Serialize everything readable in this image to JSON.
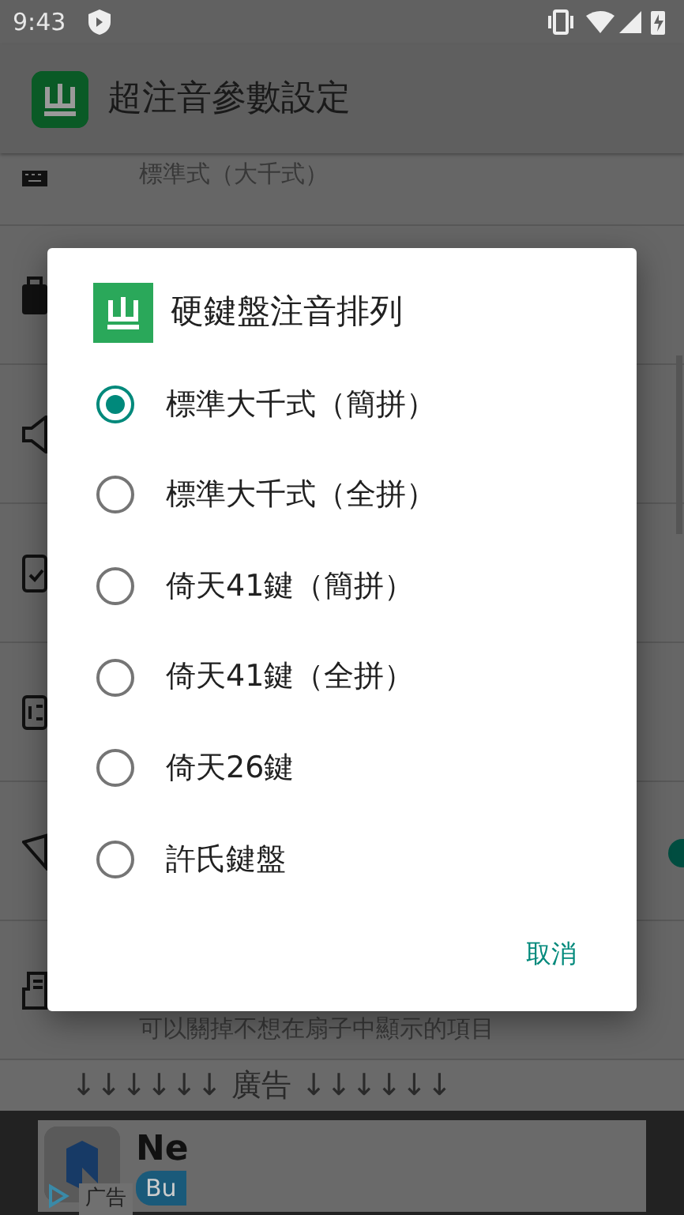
{
  "status_bar": {
    "time": "9:43"
  },
  "app_bar": {
    "title": "超注音參數設定"
  },
  "settings": [
    {
      "kind": "keyboard",
      "summary": "標準式（大千式）"
    },
    {
      "kind": "box"
    },
    {
      "kind": "speaker"
    },
    {
      "kind": "phone"
    },
    {
      "kind": "digits"
    },
    {
      "kind": "fan",
      "on": true
    },
    {
      "kind": "document",
      "summary": "可以關掉不想在扇子中顯示的項目"
    }
  ],
  "ad_label": "↓↓↓↓↓↓ 廣告 ↓↓↓↓↓↓",
  "ad": {
    "title": "Ne",
    "button": "Bu",
    "tag": "广告"
  },
  "dialog": {
    "title": "硬鍵盤注音排列",
    "options": [
      {
        "label": "標準大千式（簡拼）",
        "selected": true
      },
      {
        "label": "標準大千式（全拼）",
        "selected": false
      },
      {
        "label": "倚天41鍵（簡拼）",
        "selected": false
      },
      {
        "label": "倚天41鍵（全拼）",
        "selected": false
      },
      {
        "label": "倚天26鍵",
        "selected": false
      },
      {
        "label": "許氏鍵盤",
        "selected": false
      }
    ],
    "cancel": "取消"
  }
}
